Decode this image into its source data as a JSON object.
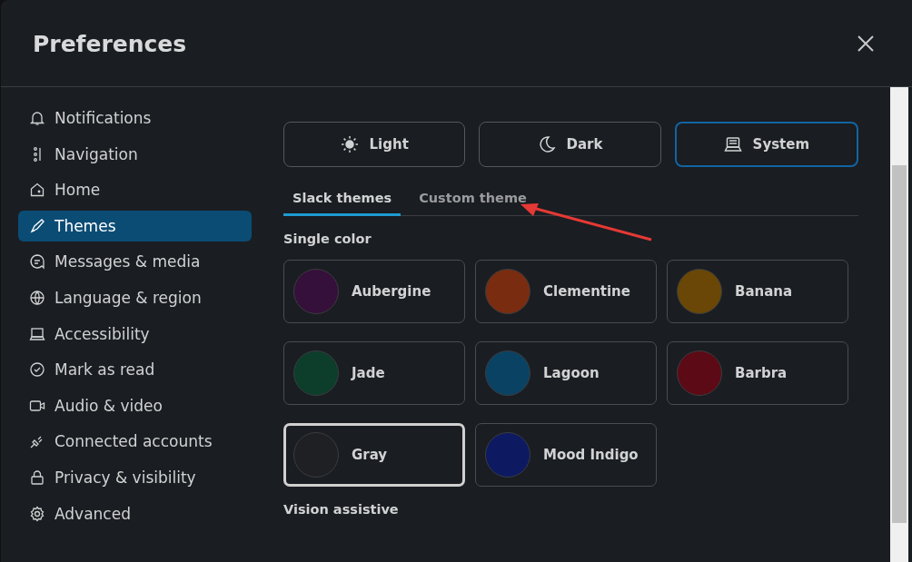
{
  "window": {
    "title": "Preferences"
  },
  "sidebar": {
    "items": [
      {
        "label": "Notifications",
        "selected": false
      },
      {
        "label": "Navigation",
        "selected": false
      },
      {
        "label": "Home",
        "selected": false
      },
      {
        "label": "Themes",
        "selected": true
      },
      {
        "label": "Messages & media",
        "selected": false
      },
      {
        "label": "Language & region",
        "selected": false
      },
      {
        "label": "Accessibility",
        "selected": false
      },
      {
        "label": "Mark as read",
        "selected": false
      },
      {
        "label": "Audio & video",
        "selected": false
      },
      {
        "label": "Connected accounts",
        "selected": false
      },
      {
        "label": "Privacy & visibility",
        "selected": false
      },
      {
        "label": "Advanced",
        "selected": false
      }
    ]
  },
  "modes": [
    {
      "label": "Light",
      "selected": false
    },
    {
      "label": "Dark",
      "selected": false
    },
    {
      "label": "System",
      "selected": true
    }
  ],
  "tabs": [
    {
      "label": "Slack themes",
      "selected": true
    },
    {
      "label": "Custom theme",
      "selected": false
    }
  ],
  "sections": [
    {
      "title": "Single color",
      "themes": [
        {
          "label": "Aubergine",
          "color": "#35103a",
          "selected": false
        },
        {
          "label": "Clementine",
          "color": "#7a2c10",
          "selected": false
        },
        {
          "label": "Banana",
          "color": "#6a4706",
          "selected": false
        },
        {
          "label": "Jade",
          "color": "#0d3d2b",
          "selected": false
        },
        {
          "label": "Lagoon",
          "color": "#0a4263",
          "selected": false
        },
        {
          "label": "Barbra",
          "color": "#5c0a15",
          "selected": false
        },
        {
          "label": "Gray",
          "color": "#1f2023",
          "selected": true
        },
        {
          "label": "Mood Indigo",
          "color": "#0d1a62",
          "selected": false
        }
      ]
    },
    {
      "title": "Vision assistive"
    }
  ]
}
